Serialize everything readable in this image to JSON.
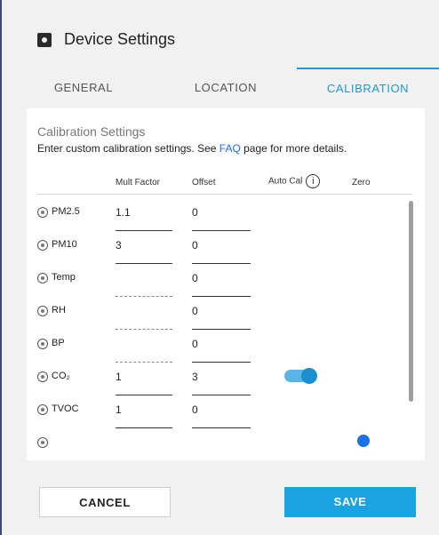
{
  "dialog": {
    "title": "Device Settings",
    "icon": "gear-icon"
  },
  "tabs": [
    {
      "label": "GENERAL",
      "active": false
    },
    {
      "label": "LOCATION",
      "active": false
    },
    {
      "label": "CALIBRATION",
      "active": true
    }
  ],
  "calibration": {
    "title": "Calibration Settings",
    "desc_before": "Enter custom calibration settings. See ",
    "faq_link": "FAQ",
    "desc_after": " page for more details.",
    "columns": {
      "mult": "Mult Factor",
      "offset": "Offset",
      "autocal": "Auto Cal",
      "zero": "Zero",
      "info_glyph": "i"
    },
    "rows": [
      {
        "label": "PM2.5",
        "mult": "1.1",
        "offset": "0",
        "mult_disabled": false,
        "autocal": false,
        "zero": false
      },
      {
        "label": "PM10",
        "mult": "3",
        "offset": "0",
        "mult_disabled": false,
        "autocal": false,
        "zero": false
      },
      {
        "label": "Temp",
        "mult": "",
        "offset": "0",
        "mult_disabled": true,
        "autocal": false,
        "zero": false
      },
      {
        "label": "RH",
        "mult": "",
        "offset": "0",
        "mult_disabled": true,
        "autocal": false,
        "zero": false
      },
      {
        "label": "BP",
        "mult": "",
        "offset": "0",
        "mult_disabled": true,
        "autocal": false,
        "zero": false
      },
      {
        "label": "CO₂",
        "mult": "1",
        "offset": "3",
        "mult_disabled": false,
        "autocal": true,
        "zero": false
      },
      {
        "label": "TVOC",
        "mult": "1",
        "offset": "0",
        "mult_disabled": false,
        "autocal": false,
        "zero": false
      },
      {
        "label": "",
        "mult": "",
        "offset": "",
        "mult_disabled": false,
        "autocal": false,
        "zero": true
      }
    ]
  },
  "buttons": {
    "cancel": "CANCEL",
    "save": "SAVE"
  },
  "colors": {
    "accent": "#1a9bd7",
    "save_bg": "#1aa3e2"
  }
}
